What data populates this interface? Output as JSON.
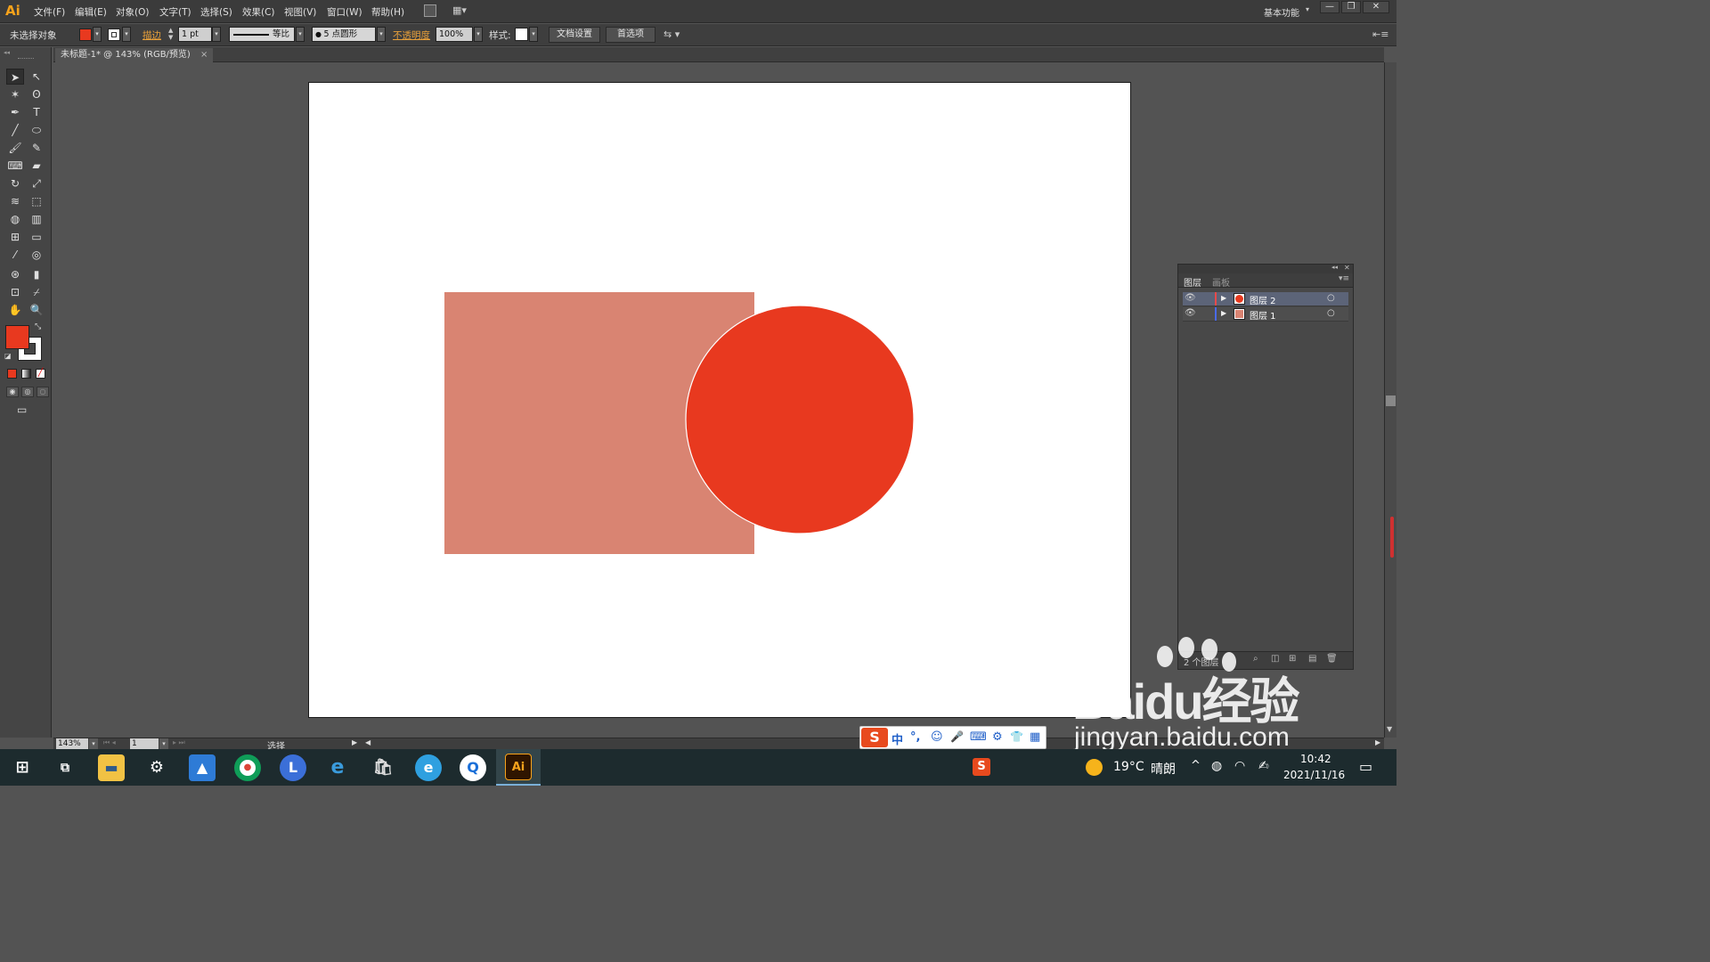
{
  "app": {
    "logo": "Ai",
    "workspace": "基本功能"
  },
  "menu": [
    "文件(F)",
    "编辑(E)",
    "对象(O)",
    "文字(T)",
    "选择(S)",
    "效果(C)",
    "视图(V)",
    "窗口(W)",
    "帮助(H)"
  ],
  "control": {
    "selection_status": "未选择对象",
    "stroke_label": "描边",
    "stroke_weight": "1 pt",
    "stroke_profile": "等比",
    "brush": "5 点圆形",
    "opacity_label": "不透明度",
    "opacity_value": "100%",
    "style_label": "样式:",
    "doc_setup": "文档设置",
    "preferences": "首选项",
    "fill_color": "#e8391f",
    "stroke_color": "#ffffff"
  },
  "document": {
    "tab_title": "未标题-1* @ 143% (RGB/预览)",
    "tab_close": "×"
  },
  "artwork": {
    "rect_color": "#d98472",
    "circle_color": "#e8391f",
    "circle_stroke": "#ffffff"
  },
  "layers_panel": {
    "tabs": [
      "图层",
      "画板"
    ],
    "layers": [
      {
        "name": "图层 2",
        "color": "#e8391f",
        "selected": true
      },
      {
        "name": "图层 1",
        "color": "#d98472",
        "selected": false
      }
    ],
    "footer": "2 个图层"
  },
  "status": {
    "zoom": "143%",
    "artboard_num": "1",
    "tool_status": "选择"
  },
  "ime": {
    "items": [
      "中",
      "°,",
      "☺",
      "🎤",
      "⌨",
      "⚙",
      "👕",
      "▦"
    ]
  },
  "taskbar": {
    "weather_temp": "19°C",
    "weather_text": "晴朗",
    "time": "10:42",
    "date": "2021/11/16",
    "apps": [
      "Windows",
      "Task View",
      "Explorer",
      "Settings",
      "Photos",
      "Chrome",
      "L",
      "IE",
      "Store",
      "Edge",
      "Browser",
      "Ai"
    ]
  },
  "watermark": {
    "brand": "Baidu经验",
    "url": "jingyan.baidu.com"
  }
}
